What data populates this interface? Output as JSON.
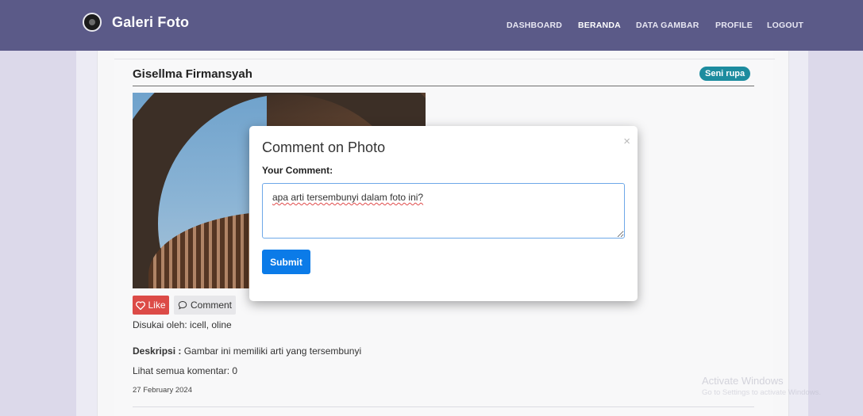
{
  "navbar": {
    "brand_title": "Galeri Foto",
    "links": [
      {
        "label": "DASHBOARD"
      },
      {
        "label": "BERANDA"
      },
      {
        "label": "DATA GAMBAR"
      },
      {
        "label": "PROFILE"
      },
      {
        "label": "LOGOUT"
      }
    ]
  },
  "post": {
    "author": "Gisellma Firmansyah",
    "category": "Seni rupa",
    "like_label": "Like",
    "comment_label": "Comment",
    "liked_by": "Disukai oleh: icell, oline",
    "description_label": "Deskripsi :",
    "description": "Gambar ini memiliki arti yang tersembunyi",
    "see_comments": "Lihat semua komentar: 0",
    "date": "27 February 2024"
  },
  "modal": {
    "title": "Comment on Photo",
    "close": "×",
    "field_label": "Your Comment:",
    "comment_value": "apa arti tersembunyi dalam foto ini?",
    "submit_label": "Submit"
  },
  "watermark": {
    "line1": "Activate Windows",
    "line2": "Go to Settings to activate Windows."
  },
  "colors": {
    "navbar": "#5b5a88",
    "like": "#dc4b47",
    "badge": "#1d8c9f",
    "submit": "#0b7be8"
  },
  "icons": [
    "camera-logo-icon",
    "heart-icon",
    "speech-bubble-icon",
    "close-icon"
  ]
}
